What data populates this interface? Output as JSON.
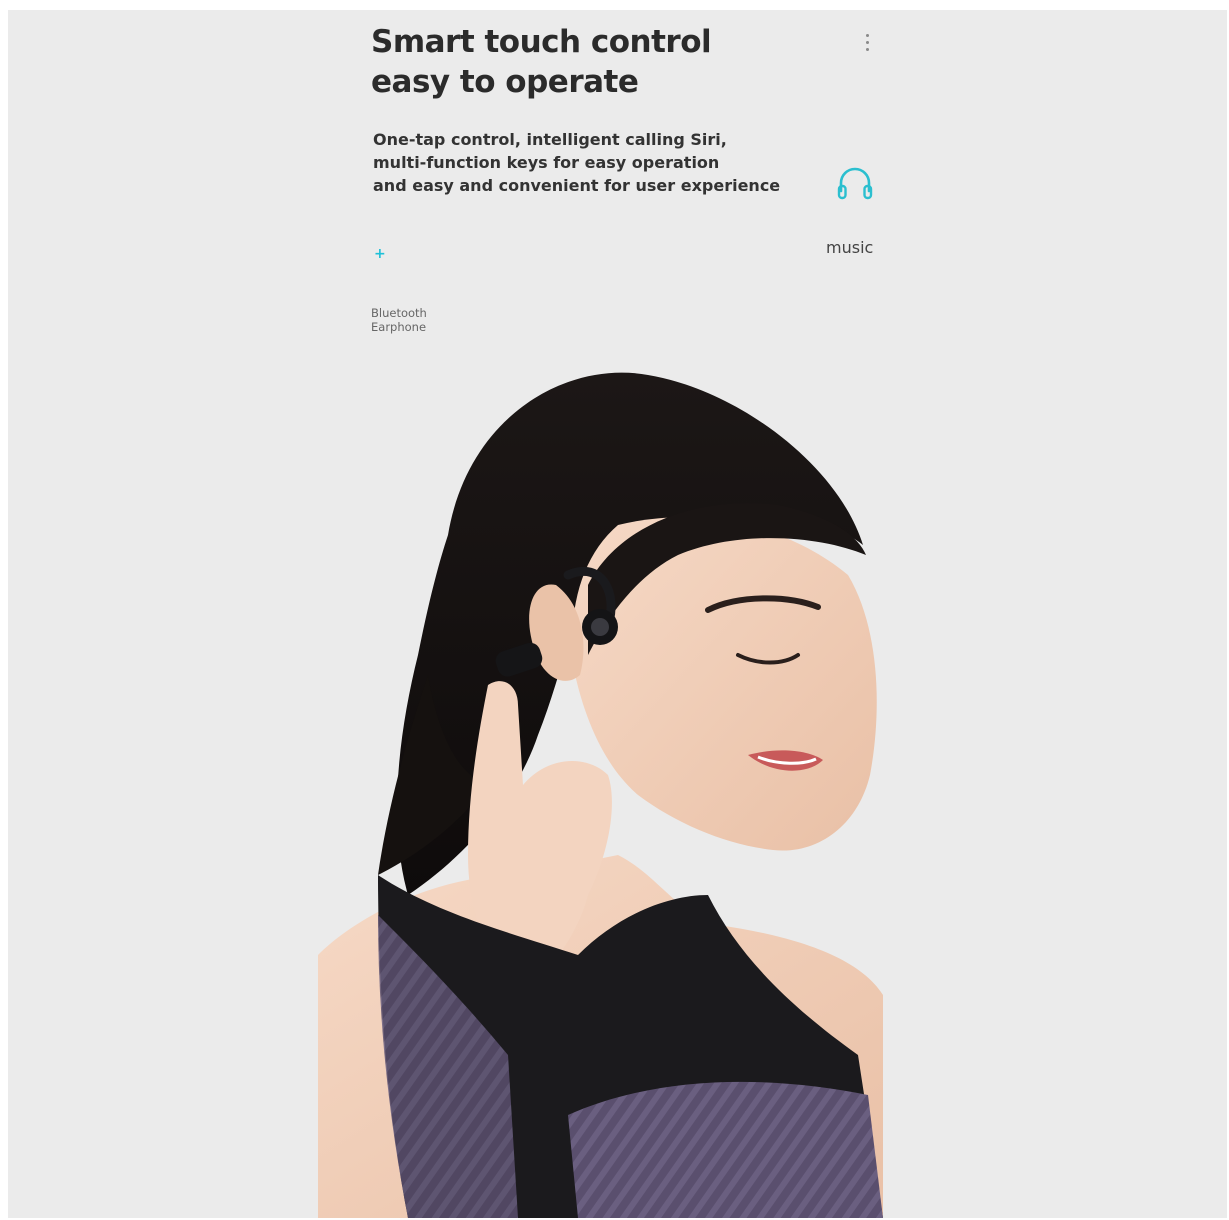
{
  "heading": {
    "line1": "Smart touch control",
    "line2": "easy to operate"
  },
  "description": {
    "line1": "One-tap control, intelligent calling Siri,",
    "line2": "multi-function keys for easy operation",
    "line3": "and easy and convenient for user experience"
  },
  "feature": {
    "icon": "headphones-icon",
    "label": "music",
    "accent_color": "#2bbfcf"
  },
  "plus_symbol": "+",
  "product": {
    "line1": "Bluetooth",
    "line2": "Earphone"
  },
  "menu": {
    "icon": "kebab-menu-icon"
  },
  "photo": {
    "subject": "woman wearing an open-ear bluetooth earphone, touching the ear control"
  }
}
